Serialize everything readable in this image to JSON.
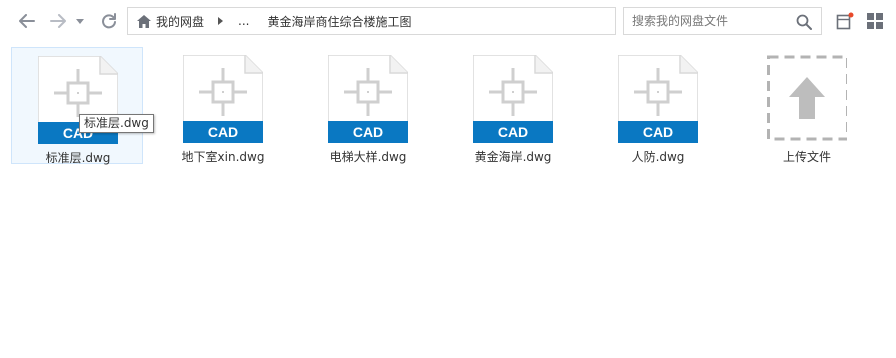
{
  "toolbar": {
    "back_icon": "arrow-left-icon",
    "forward_icon": "arrow-right-icon",
    "dropdown_icon": "chevron-down-icon",
    "refresh_icon": "refresh-icon"
  },
  "breadcrumb": {
    "home_icon": "home-icon",
    "root_label": "我的网盘",
    "ellipsis": "...",
    "current_folder": "黄金海岸商住综合楼施工图"
  },
  "search": {
    "placeholder": "搜索我的网盘文件",
    "icon": "search-icon"
  },
  "view": {
    "detail_icon": "detail-view-icon",
    "grid_icon": "grid-view-icon",
    "notification_dot_color": "#e8492a"
  },
  "files": [
    {
      "name": "标准层.dwg",
      "badge": "CAD"
    },
    {
      "name": "地下室xin.dwg",
      "badge": "CAD"
    },
    {
      "name": "电梯大样.dwg",
      "badge": "CAD"
    },
    {
      "name": "黄金海岸.dwg",
      "badge": "CAD"
    },
    {
      "name": "人防.dwg",
      "badge": "CAD"
    }
  ],
  "upload": {
    "label": "上传文件",
    "icon": "upload-arrow-icon"
  },
  "tooltip": {
    "text": "标准层.dwg"
  },
  "colors": {
    "cad_badge": "#0a78c2",
    "selection_bg": "#f1f8fe",
    "icon_gray": "#cfcfcf"
  }
}
